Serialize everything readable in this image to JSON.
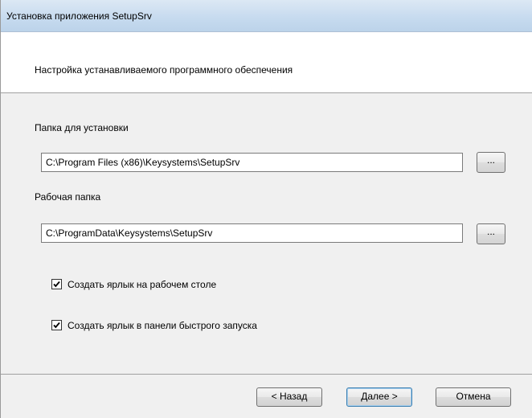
{
  "window": {
    "title": "Установка приложения SetupSrv"
  },
  "header": {
    "text": "Настройка устанавливаемого программного обеспечения"
  },
  "install_folder": {
    "label": "Папка для установки",
    "value": "C:\\Program Files (x86)\\Keysystems\\SetupSrv",
    "browse_label": "..."
  },
  "work_folder": {
    "label": "Рабочая папка",
    "value": "C:\\ProgramData\\Keysystems\\SetupSrv",
    "browse_label": "..."
  },
  "options": [
    {
      "label": "Создать ярлык на рабочем столе",
      "checked": true
    },
    {
      "label": "Создать ярлык в панели быстрого запуска",
      "checked": true
    }
  ],
  "footer": {
    "back_label": "< Назад",
    "next_label": "Далее >",
    "cancel_label": "Отмена"
  }
}
